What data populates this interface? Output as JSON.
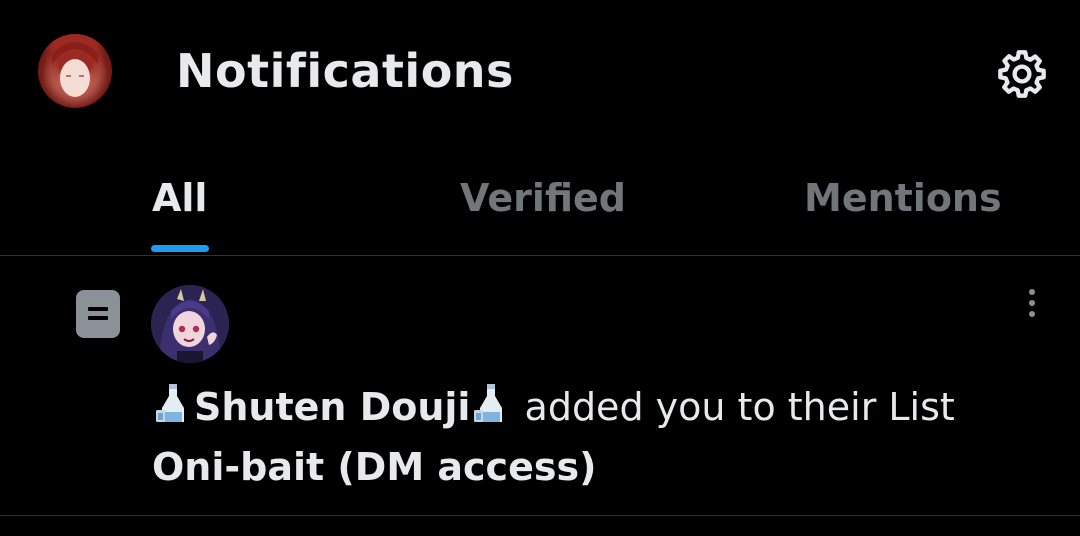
{
  "header": {
    "title": "Notifications",
    "settings_icon": "gear-icon",
    "avatar_icon": "profile-avatar"
  },
  "tabs": [
    {
      "label": "All",
      "selected": true
    },
    {
      "label": "Verified",
      "selected": false
    },
    {
      "label": "Mentions",
      "selected": false
    }
  ],
  "notification": {
    "type_icon": "list-icon",
    "user_display_name": "Shuten Douji",
    "name_emoji": "sake-bottle-icon",
    "action_text": " added you to their List",
    "list_name": "Oni-bait (DM access)",
    "more_icon": "more-vertical-icon"
  },
  "colors": {
    "background": "#000000",
    "text_primary": "#e7e9ea",
    "text_secondary": "#71767b",
    "accent": "#1d9bf0",
    "divider": "#2f3336"
  }
}
